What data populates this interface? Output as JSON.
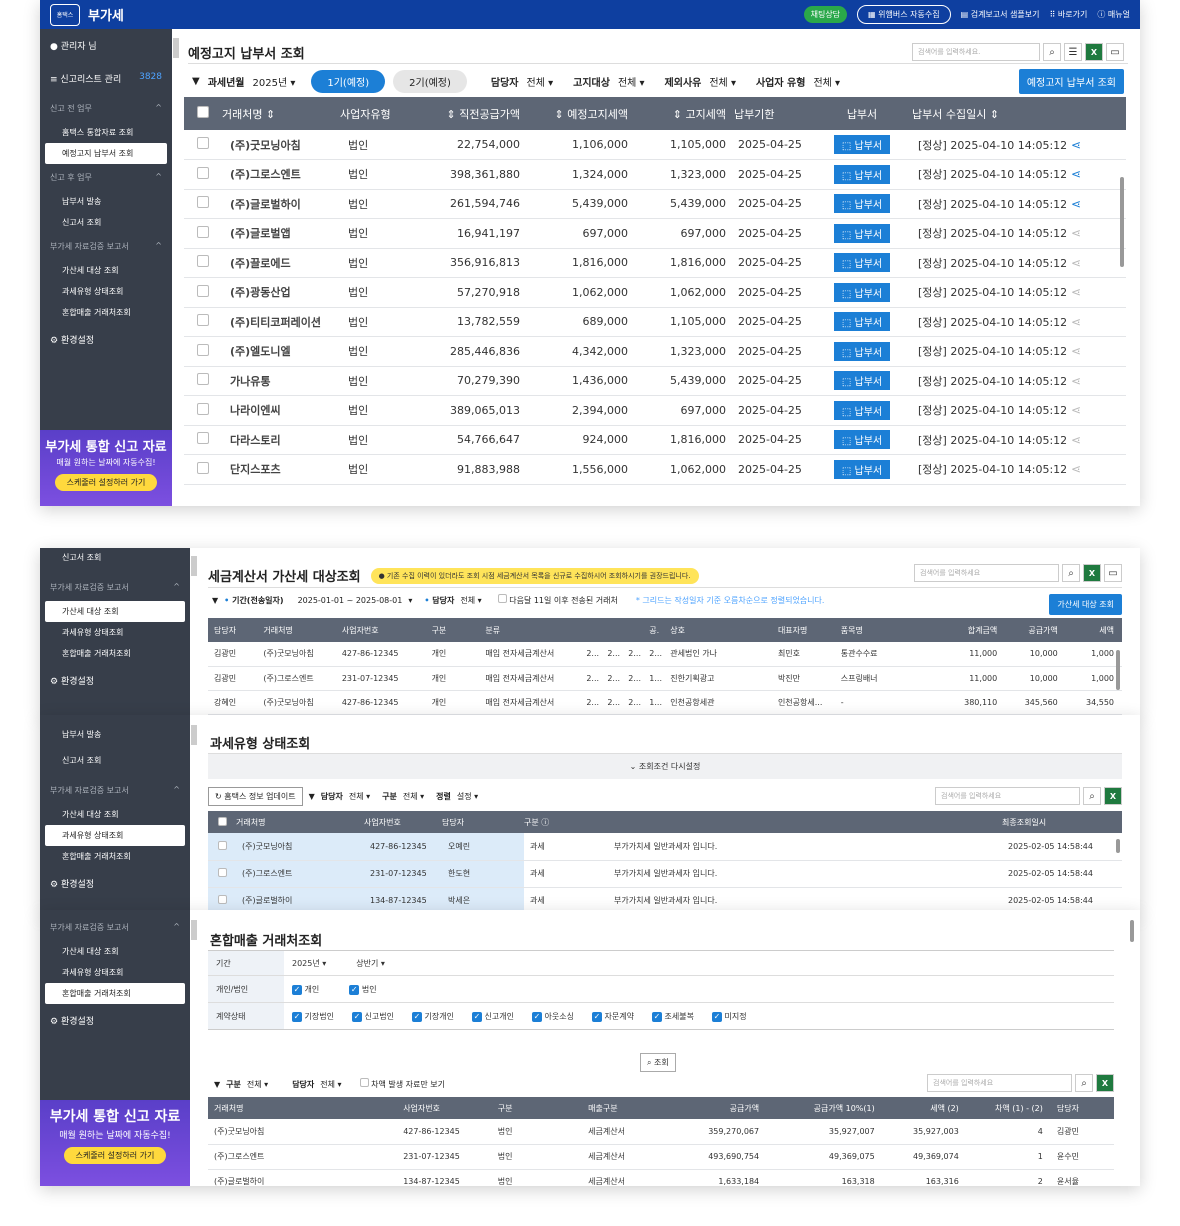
{
  "p1": {
    "app_title": "부가세",
    "logo_text": "홈택스",
    "top": {
      "chat": "채팅상담",
      "collect": "위햄버스 자동수집",
      "sample": "검계보고서 샘플보기",
      "shortcut": "바로가기",
      "manual": "매뉴얼"
    },
    "sidebar": {
      "user": "관리자 님",
      "client_mgmt": "신고리스트 관리",
      "client_count": "3828",
      "sec1": "신고 전 업무",
      "i1": "홈택스 통합자료 조회",
      "i2": "예정고지 납부서 조회",
      "sec2": "신고 후 업무",
      "i3": "납부서 발송",
      "i4": "신고서 조회",
      "sec3": "부가세 자료검증 보고서",
      "i5": "가산세 대상 조회",
      "i6": "과세유형 상태조회",
      "i7": "혼합매출 거래처조회",
      "settings": "환경설정"
    },
    "promo": {
      "title": "부가세 통합 신고 자료",
      "sub": "매월 원하는 날짜에 자동수집!",
      "btn": "스케줄러 설정하러 가기"
    },
    "page_title": "예정고지 납부서 조회",
    "search_placeholder": "검색어를 입력하세요.",
    "filters": {
      "year_label": "과세년월",
      "year": "2025년",
      "tab1": "1기(예정)",
      "tab2": "2기(예정)",
      "mgr_label": "담당자",
      "mgr": "전체",
      "target_label": "고지대상",
      "target": "전체",
      "except_label": "제외사유",
      "except": "전체",
      "biz_label": "사업자 유형",
      "biz": "전체",
      "btn": "예정고지 납부서 조회"
    },
    "headers": [
      "거래처명",
      "사업자유형",
      "직전공급가액",
      "예정고지세액",
      "고지세액",
      "납부기한",
      "납부서",
      "납부서 수집일시"
    ],
    "pdf_label": "납부서",
    "rows": [
      [
        "(주)굿모닝아침",
        "법인",
        "22,754,000",
        "1,106,000",
        "1,105,000",
        "2025-04-25",
        "[정상] 2025-04-10 14:05:12"
      ],
      [
        "(주)그로스엔트",
        "법인",
        "398,361,880",
        "1,324,000",
        "1,323,000",
        "2025-04-25",
        "[정상] 2025-04-10 14:05:12"
      ],
      [
        "(주)글로벌하이",
        "법인",
        "261,594,746",
        "5,439,000",
        "5,439,000",
        "2025-04-25",
        "[정상] 2025-04-10 14:05:12"
      ],
      [
        "(주)글로벌앱",
        "법인",
        "16,941,197",
        "697,000",
        "697,000",
        "2025-04-25",
        "[정상] 2025-04-10 14:05:12"
      ],
      [
        "(주)끌로에드",
        "법인",
        "356,916,813",
        "1,816,000",
        "1,816,000",
        "2025-04-25",
        "[정상] 2025-04-10 14:05:12"
      ],
      [
        "(주)광동산업",
        "법인",
        "57,270,918",
        "1,062,000",
        "1,062,000",
        "2025-04-25",
        "[정상] 2025-04-10 14:05:12"
      ],
      [
        "(주)티티코퍼레이션",
        "법인",
        "13,782,559",
        "689,000",
        "1,105,000",
        "2025-04-25",
        "[정상] 2025-04-10 14:05:12"
      ],
      [
        "(주)엘도니엘",
        "법인",
        "285,446,836",
        "4,342,000",
        "1,323,000",
        "2025-04-25",
        "[정상] 2025-04-10 14:05:12"
      ],
      [
        "가나유통",
        "법인",
        "70,279,390",
        "1,436,000",
        "5,439,000",
        "2025-04-25",
        "[정상] 2025-04-10 14:05:12"
      ],
      [
        "나라이엔씨",
        "법인",
        "389,065,013",
        "2,394,000",
        "697,000",
        "2025-04-25",
        "[정상] 2025-04-10 14:05:12"
      ],
      [
        "다라스토리",
        "법인",
        "54,766,647",
        "924,000",
        "1,816,000",
        "2025-04-25",
        "[정상] 2025-04-10 14:05:12"
      ],
      [
        "단지스포츠",
        "법인",
        "91,883,988",
        "1,556,000",
        "1,062,000",
        "2025-04-25",
        "[정상] 2025-04-10 14:05:12"
      ]
    ]
  },
  "p2": {
    "sidebar": {
      "i0": "신고서 조회",
      "sec": "부가세 자료검증 보고서",
      "i1": "가산세 대상 조회",
      "i2": "과세유형 상태조회",
      "i3": "혼합매출 거래처조회",
      "settings": "환경설정"
    },
    "title": "세금계산서 가산세 대상조회",
    "notice": "● 기존 수집 이력이 있더라도 조회 시점 세금계산서 목록을 신규로 수집하시어 조회하시기를 권장드립니다.",
    "search_placeholder": "검색어를 입력하세요",
    "f_period_label": "기간(전송일자)",
    "f_period": "2025-01-01 ~ 2025-08-01",
    "f_mgr_label": "담당자",
    "f_mgr": "전체",
    "f_check": "다음달 11일 이후 전송된 거래처",
    "f_note": "* 그리드는 작성일자 기준 오름차순으로 정렬되었습니다.",
    "btn": "가산세 대상 조회",
    "headers": [
      "담당자",
      "거래처명",
      "사업자번호",
      "구분",
      "분류",
      "",
      "",
      "",
      "공.",
      "상호",
      "대표자명",
      "품목명",
      "합계금액",
      "공급가액",
      "세액"
    ],
    "rows": [
      [
        "김광민",
        "(주)굿모닝아침",
        "427-86-12345",
        "개인",
        "매입 전자세금계산서",
        "2...",
        "2...",
        "2...",
        "2...",
        "관세법인 가나",
        "최민호",
        "통관수수료",
        "11,000",
        "10,000",
        "1,000"
      ],
      [
        "김광민",
        "(주)그로스엔트",
        "231-07-12345",
        "개인",
        "매입 전자세금계산서",
        "2...",
        "2...",
        "2...",
        "1...",
        "진한기획광고",
        "박진만",
        "스프링배너",
        "11,000",
        "10,000",
        "1,000"
      ],
      [
        "강혜인",
        "(주)굿모닝아침",
        "427-86-12345",
        "개인",
        "매입 전자세금계산서",
        "2...",
        "2...",
        "2...",
        "1...",
        "인천공항세관",
        "인천공항세...",
        "-",
        "380,110",
        "345,560",
        "34,550"
      ]
    ]
  },
  "p3": {
    "sidebar": {
      "i0": "납부서 발송",
      "i1": "신고서 조회",
      "sec": "부가세 자료검증 보고서",
      "i2": "가산세 대상 조회",
      "i3": "과세유형 상태조회",
      "i4": "혼합매출 거래처조회",
      "settings": "환경설정"
    },
    "title": "과세유형 상태조회",
    "reset": "조회조건 다시설정",
    "update_btn": "홈택스 정보 업데이트",
    "f_mgr_label": "담당자",
    "f_mgr": "전체",
    "f_type_label": "구분",
    "f_type": "전체",
    "f_sort_label": "정렬",
    "f_sort": "설정",
    "search_placeholder": "검색어를 입력하세요",
    "headers": [
      "거래처명",
      "사업자번호",
      "담당자",
      "구분",
      "",
      "최종조회일시"
    ],
    "rows": [
      [
        "(주)굿모닝아침",
        "427-86-12345",
        "오예린",
        "과세",
        "부가가치세 일반과세자 입니다.",
        "2025-02-05 14:58:44"
      ],
      [
        "(주)그로스엔트",
        "231-07-12345",
        "한도현",
        "과세",
        "부가가치세 일반과세자 입니다.",
        "2025-02-05 14:58:44"
      ],
      [
        "(주)글로벌하이",
        "134-87-12345",
        "박세은",
        "과세",
        "부가가치세 일반과세자 입니다.",
        "2025-02-05 14:58:44"
      ]
    ]
  },
  "p4": {
    "sidebar": {
      "sec": "부가세 자료검증 보고서",
      "i1": "가산세 대상 조회",
      "i2": "과세유형 상태조회",
      "i3": "혼합매출 거래처조회",
      "settings": "환경설정"
    },
    "promo": {
      "title": "부가세 통합 신고 자료",
      "sub": "매월 원하는 날짜에 자동수집!",
      "btn": "스케줄러 설정하러 가기"
    },
    "title": "혼합매출 거래처조회",
    "period_label": "기간",
    "year": "2025년",
    "half": "상반기",
    "type_label": "개인/법인",
    "type_opts": [
      "개인",
      "법인"
    ],
    "status_label": "계약상태",
    "status_opts": [
      "기장법인",
      "신고법인",
      "기장개인",
      "신고개인",
      "아웃소싱",
      "자문계약",
      "조세불복",
      "미지정"
    ],
    "query_btn": "조회",
    "f_type_label": "구분",
    "f_type": "전체",
    "f_mgr_label": "담당자",
    "f_mgr": "전체",
    "f_check": "차액 발생 자료만 보기",
    "search_placeholder": "검색어를 입력하세요",
    "headers": [
      "거래처명",
      "사업자번호",
      "구분",
      "매출구분",
      "공급가액",
      "공급가액 10%(1)",
      "세액 (2)",
      "차액 (1) - (2)",
      "담당자"
    ],
    "rows": [
      [
        "(주)굿모닝아침",
        "427-86-12345",
        "법인",
        "세금계산서",
        "359,270,067",
        "35,927,007",
        "35,927,003",
        "4",
        "김광민"
      ],
      [
        "(주)그로스엔트",
        "231-07-12345",
        "법인",
        "세금계산서",
        "493,690,754",
        "49,369,075",
        "49,369,074",
        "1",
        "윤수민"
      ],
      [
        "(주)글로벌하이",
        "134-87-12345",
        "법인",
        "세금계산서",
        "1,633,184",
        "163,318",
        "163,316",
        "2",
        "윤서율"
      ]
    ]
  }
}
